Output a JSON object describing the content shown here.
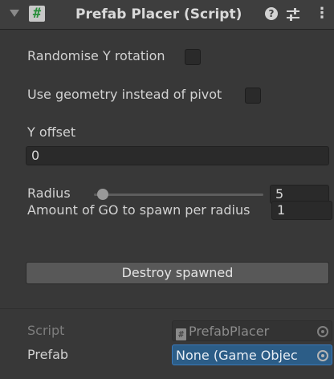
{
  "header": {
    "title": "Prefab Placer (Script)",
    "script_icon_glyph": "#",
    "help_glyph": "?",
    "menu_glyph": "⋮"
  },
  "fields": {
    "randomise_label": "Randomise Y rotation",
    "randomise_checked": false,
    "geometry_label": "Use geometry instead of pivot",
    "geometry_checked": false,
    "y_offset_label": "Y offset",
    "y_offset_value": "0",
    "radius_label": "Radius",
    "radius_value": "5",
    "radius_slider_fraction": 0.02,
    "amount_label": "Amount of GO to spawn per radius",
    "amount_value": "1"
  },
  "buttons": {
    "destroy_label": "Destroy spawned"
  },
  "references": {
    "script_label": "Script",
    "script_value": "PrefabPlacer",
    "script_icon_glyph": "#",
    "prefab_label": "Prefab",
    "prefab_value": "None (Game Objec"
  },
  "colors": {
    "background": "#383838",
    "header": "#3e3e3e",
    "field": "#2a2a2a",
    "button": "#585858",
    "selected_field": "#2c5d87",
    "selected_border": "#3a79bb",
    "script_icon_hash": "#2a8f3c"
  }
}
